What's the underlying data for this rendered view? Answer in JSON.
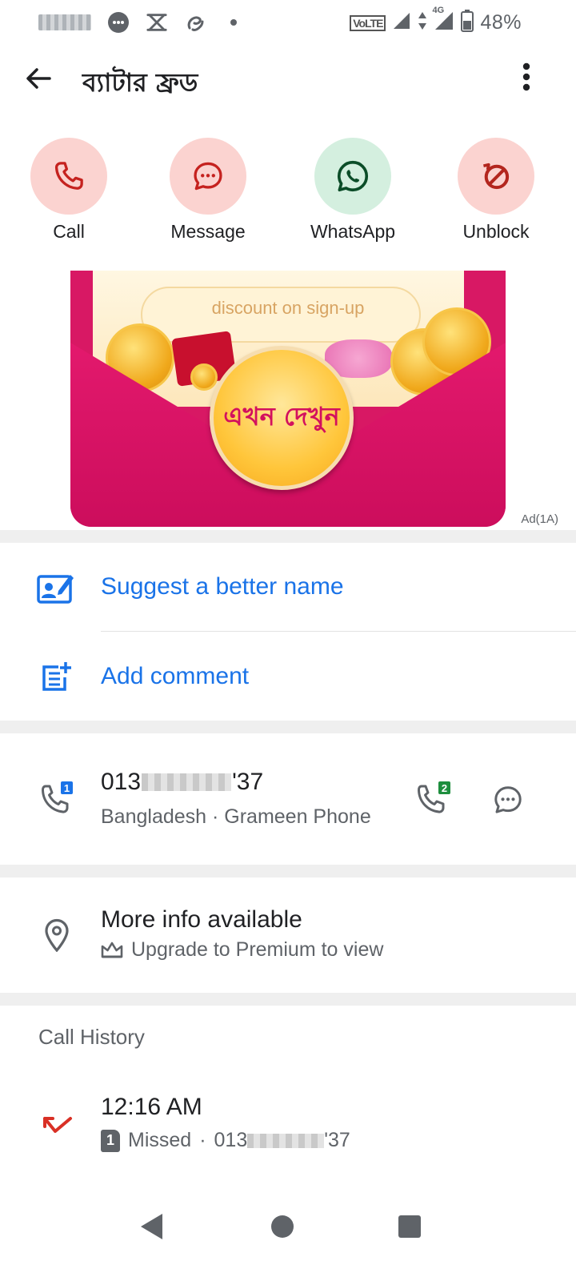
{
  "status_bar": {
    "network": "VoLTE",
    "network_gen": "4G",
    "battery_percent": "48%"
  },
  "app_bar": {
    "title": "ব্যাটার ফ্রড"
  },
  "actions": [
    {
      "label": "Call",
      "icon": "phone-icon",
      "color": "#c5221f"
    },
    {
      "label": "Message",
      "icon": "message-icon",
      "color": "#c5221f"
    },
    {
      "label": "WhatsApp",
      "icon": "whatsapp-icon",
      "color": "#0b5a2c"
    },
    {
      "label": "Unblock",
      "icon": "unblock-icon",
      "color": "#c5221f"
    }
  ],
  "ad": {
    "discount_text": "discount on sign-up",
    "cta_text": "এখন দেখুন",
    "label": "Ad(1A)"
  },
  "suggest": {
    "label": "Suggest a better name"
  },
  "comment": {
    "label": "Add comment"
  },
  "number": {
    "prefix": "013",
    "suffix": "'37",
    "sim_primary": "1",
    "sim_secondary": "2",
    "carrier_info": "Bangladesh · Grameen Phone"
  },
  "more_info": {
    "title": "More info available",
    "subtitle": "Upgrade to Premium to view"
  },
  "call_history": {
    "header": "Call History",
    "entries": [
      {
        "time": "12:16 AM",
        "sim": "1",
        "type": "Missed",
        "number_prefix": "013",
        "number_suffix": "'37"
      }
    ]
  },
  "colors": {
    "accent_blue": "#1a73e8",
    "missed_red": "#d93025"
  }
}
